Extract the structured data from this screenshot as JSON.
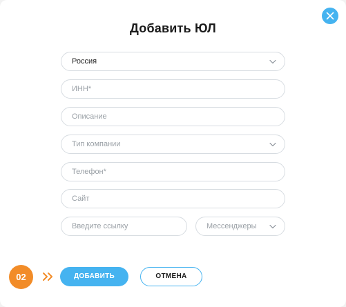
{
  "modal": {
    "title": "Добавить ЮЛ"
  },
  "form": {
    "country_value": "Россия",
    "inn_placeholder": "ИНН*",
    "description_placeholder": "Описание",
    "company_type_placeholder": "Тип компании",
    "phone_placeholder": "Телефон*",
    "site_placeholder": "Сайт",
    "link_placeholder": "Введите ссылку",
    "messengers_placeholder": "Мессенджеры"
  },
  "footer": {
    "step": "02",
    "add_label": "ДОБАВИТЬ",
    "cancel_label": "ОТМЕНА"
  },
  "icons": {
    "close": "close-icon",
    "chevron": "chevron-down-icon",
    "arrows": "double-chevron-right-icon"
  },
  "colors": {
    "accent": "#45b3f0",
    "step": "#f28c28"
  }
}
